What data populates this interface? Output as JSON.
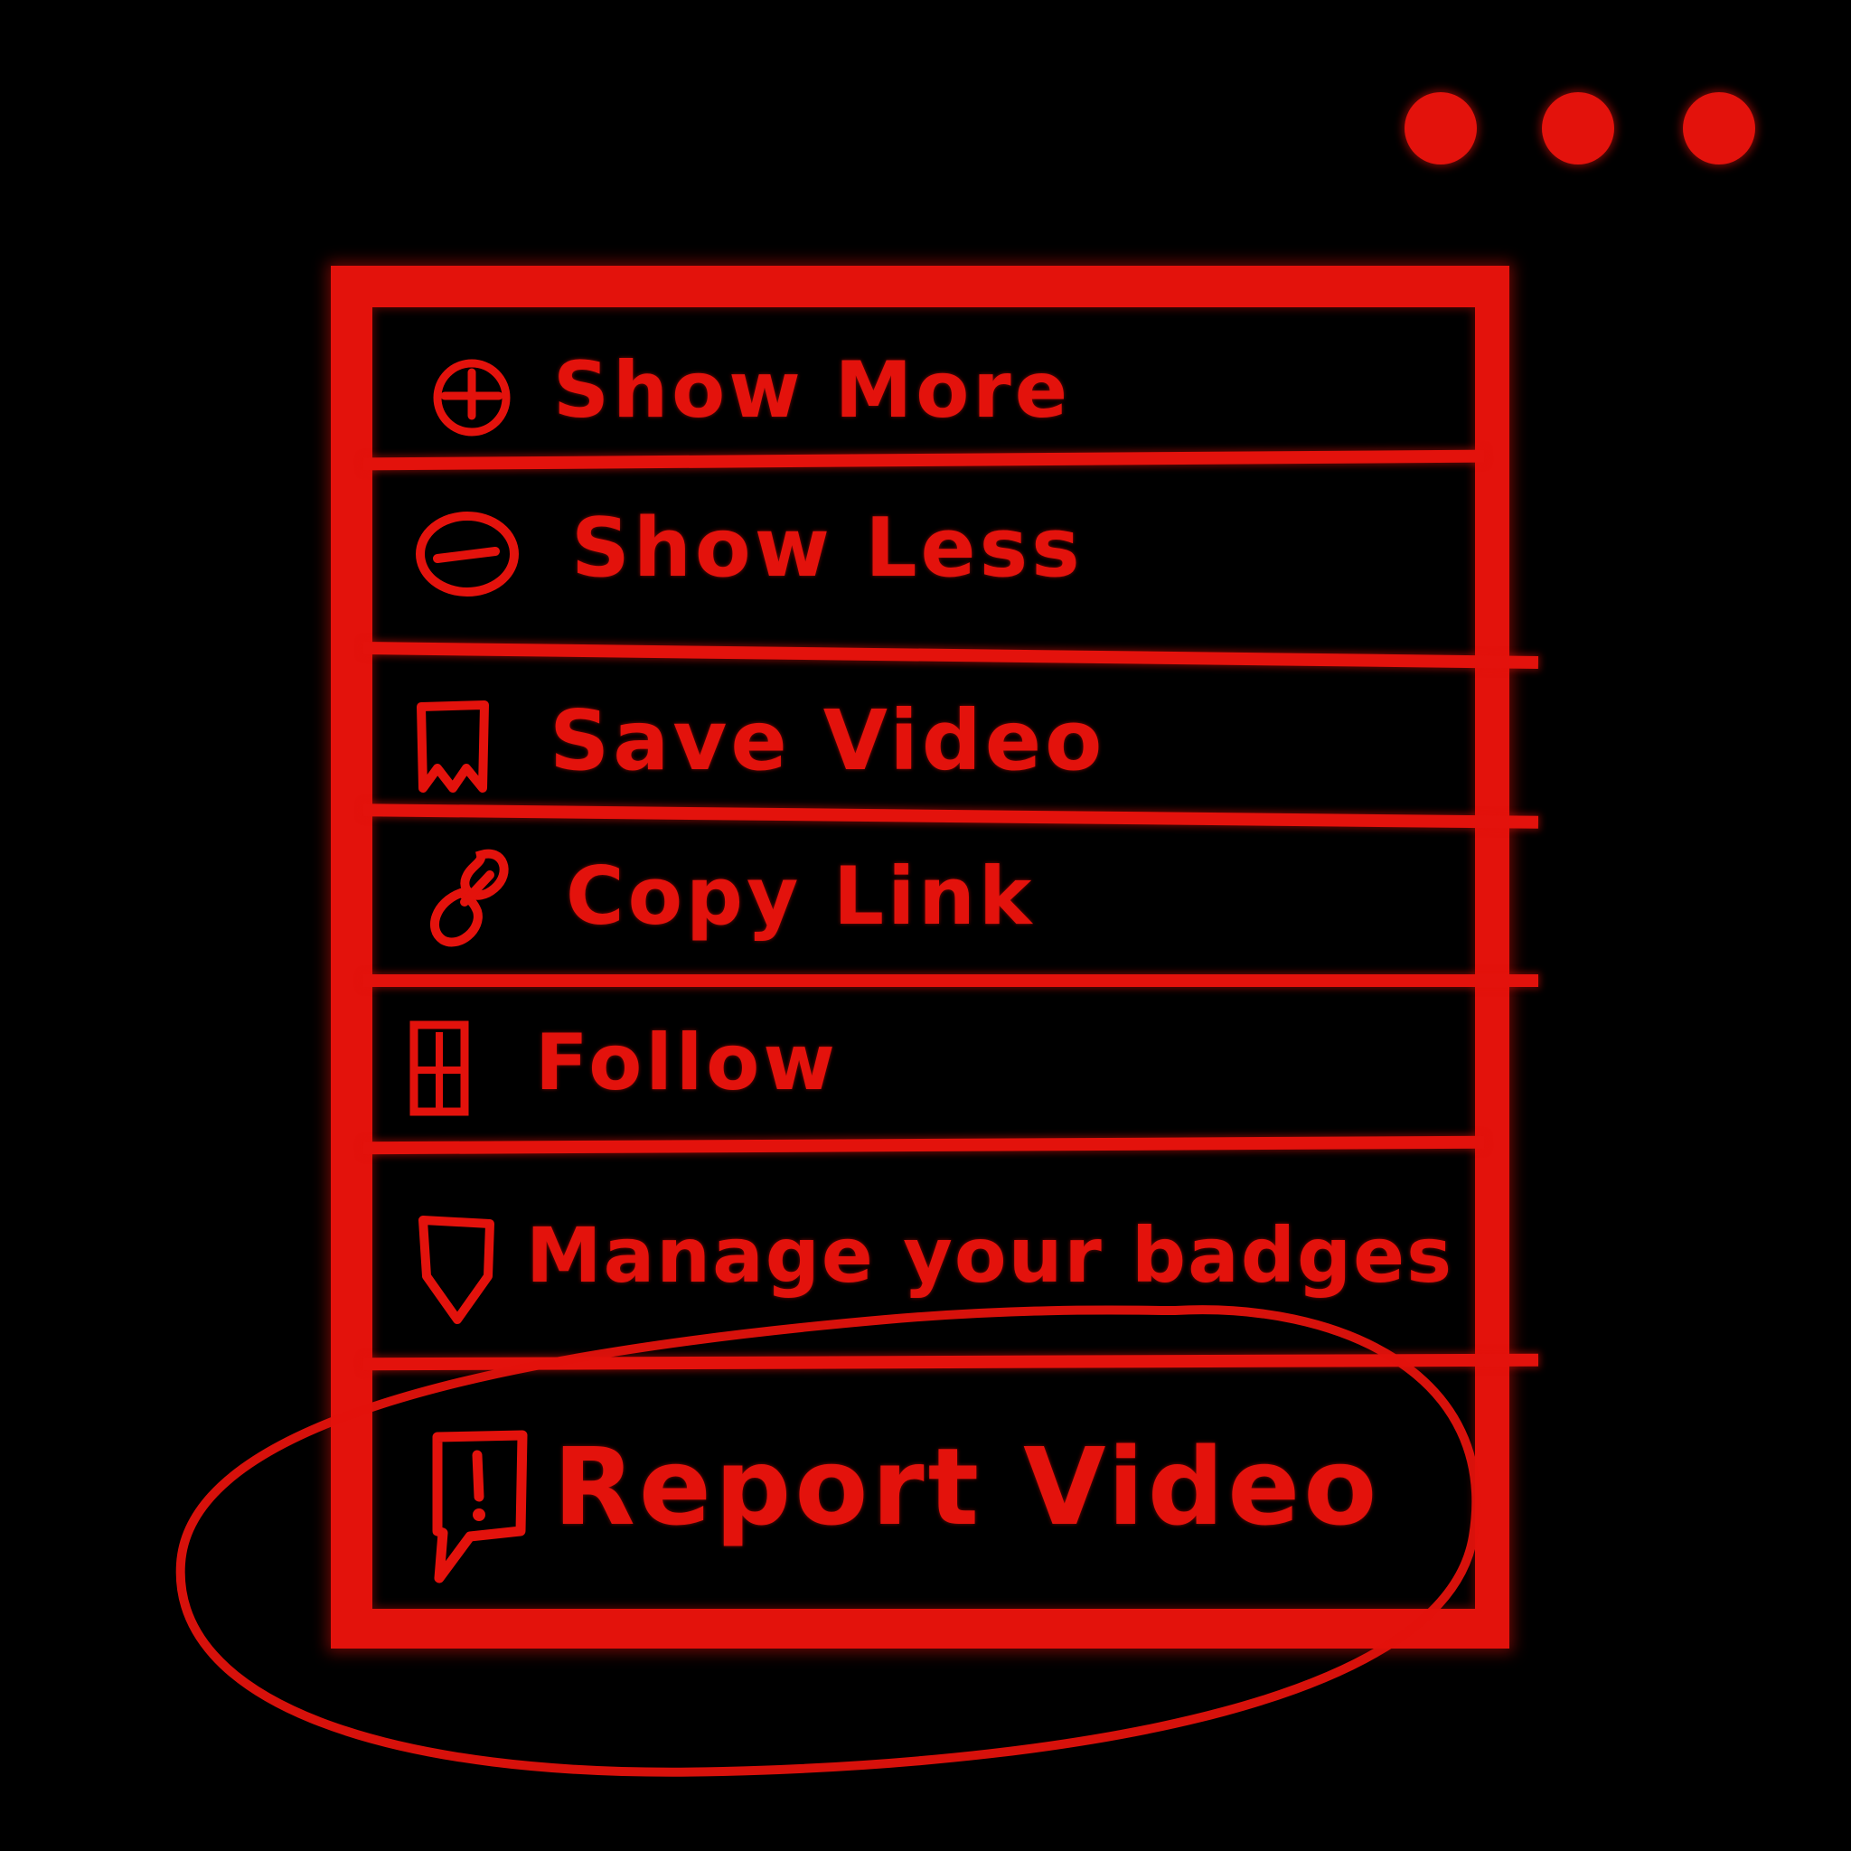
{
  "colors": {
    "accent": "#e3120c",
    "background": "#000000"
  },
  "more_button": {
    "icon": "more-horizontal-icon"
  },
  "menu": {
    "items": [
      {
        "id": "show-more",
        "label": "Show More",
        "icon": "plus-circle-icon"
      },
      {
        "id": "show-less",
        "label": "Show Less",
        "icon": "minus-circle-icon"
      },
      {
        "id": "save-video",
        "label": "Save Video",
        "icon": "bookmark-icon"
      },
      {
        "id": "copy-link",
        "label": "Copy Link",
        "icon": "link-icon"
      },
      {
        "id": "follow",
        "label": "Follow",
        "icon": "add-user-icon"
      },
      {
        "id": "manage-badges",
        "label": "Manage your badges",
        "icon": "badge-icon"
      },
      {
        "id": "report-video",
        "label": "Report Video",
        "icon": "report-flag-icon"
      }
    ],
    "highlighted_item": "report-video"
  }
}
